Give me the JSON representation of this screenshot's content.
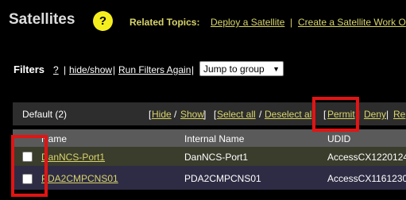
{
  "header": {
    "title": "Satellites",
    "help_glyph": "?",
    "related_label": "Related Topics:",
    "related_links": [
      "Deploy a Satellite",
      "Create a Satellite Work O"
    ],
    "separator": "|"
  },
  "filters": {
    "label": "Filters",
    "help": "?",
    "hide_show": "hide/show",
    "run_again": "Run Filters Again",
    "separator": "|",
    "jump_select": "Jump to group"
  },
  "group": {
    "title": "Default (2)",
    "hide": "Hide",
    "show": "Show",
    "select_all": "Select all",
    "deselect_all": "Deselect al",
    "permit": "Permit",
    "deny": "Deny",
    "re": "Re",
    "open_bracket": "[",
    "close_bracket": "]",
    "slash": "/",
    "pipe": "|"
  },
  "table": {
    "columns": [
      "Name",
      "Internal Name",
      "UDID"
    ],
    "rows": [
      {
        "name": "DanNCS-Port1",
        "internal": "DanNCS-Port1",
        "udid": "AccessCX1220124"
      },
      {
        "name": "PDA2CMPCNS01",
        "internal": "PDA2CMPCNS01",
        "udid": "AccessCX1161230"
      }
    ]
  },
  "colors": {
    "background": "#000000",
    "link_accent": "#d8d46a",
    "help_circle": "#f5ee1f",
    "highlight": "#e21414"
  }
}
